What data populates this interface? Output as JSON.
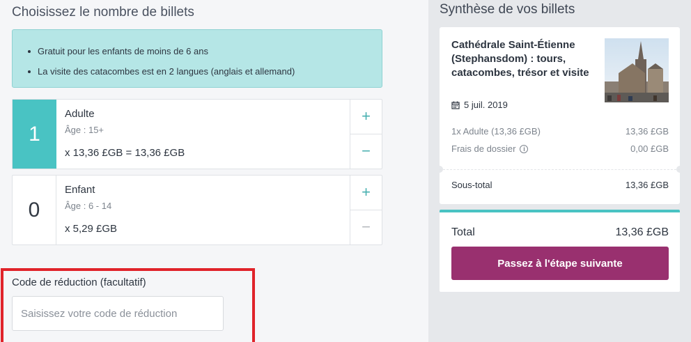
{
  "tickets_section": {
    "title": "Choisissez le nombre de billets",
    "info": [
      "Gratuit pour les enfants de moins de 6 ans",
      "La visite des catacombes est en 2 langues (anglais et allemand)"
    ],
    "tickets": [
      {
        "count": "1",
        "name": "Adulte",
        "age": "Âge : 15+",
        "price": "x 13,36 £GB = 13,36 £GB",
        "plus": "+",
        "minus": "−"
      },
      {
        "count": "0",
        "name": "Enfant",
        "age": "Âge : 6 - 14",
        "price": "x 5,29 £GB",
        "plus": "+",
        "minus": "−"
      }
    ]
  },
  "promo": {
    "label": "Code de réduction (facultatif)",
    "placeholder": "Saisissez votre code de réduction"
  },
  "summary": {
    "title": "Synthèse de vos billets",
    "product": "Cathédrale Saint-Étienne (Stephansdom) : tours, catacombes, trésor et visite",
    "date": "5 juil. 2019",
    "lines": [
      {
        "label": "1x Adulte (13,36 £GB)",
        "value": "13,36 £GB"
      },
      {
        "label": "Frais de dossier",
        "value": "0,00 £GB"
      }
    ],
    "subtotal_label": "Sous-total",
    "subtotal_value": "13,36 £GB",
    "total_label": "Total",
    "total_value": "13,36 £GB",
    "next_button": "Passez à l'étape suivante"
  },
  "colors": {
    "accent_teal": "#49c3c3",
    "info_bg": "#b5e6e6",
    "button_purple": "#99306f",
    "highlight_red": "#e0232a"
  }
}
